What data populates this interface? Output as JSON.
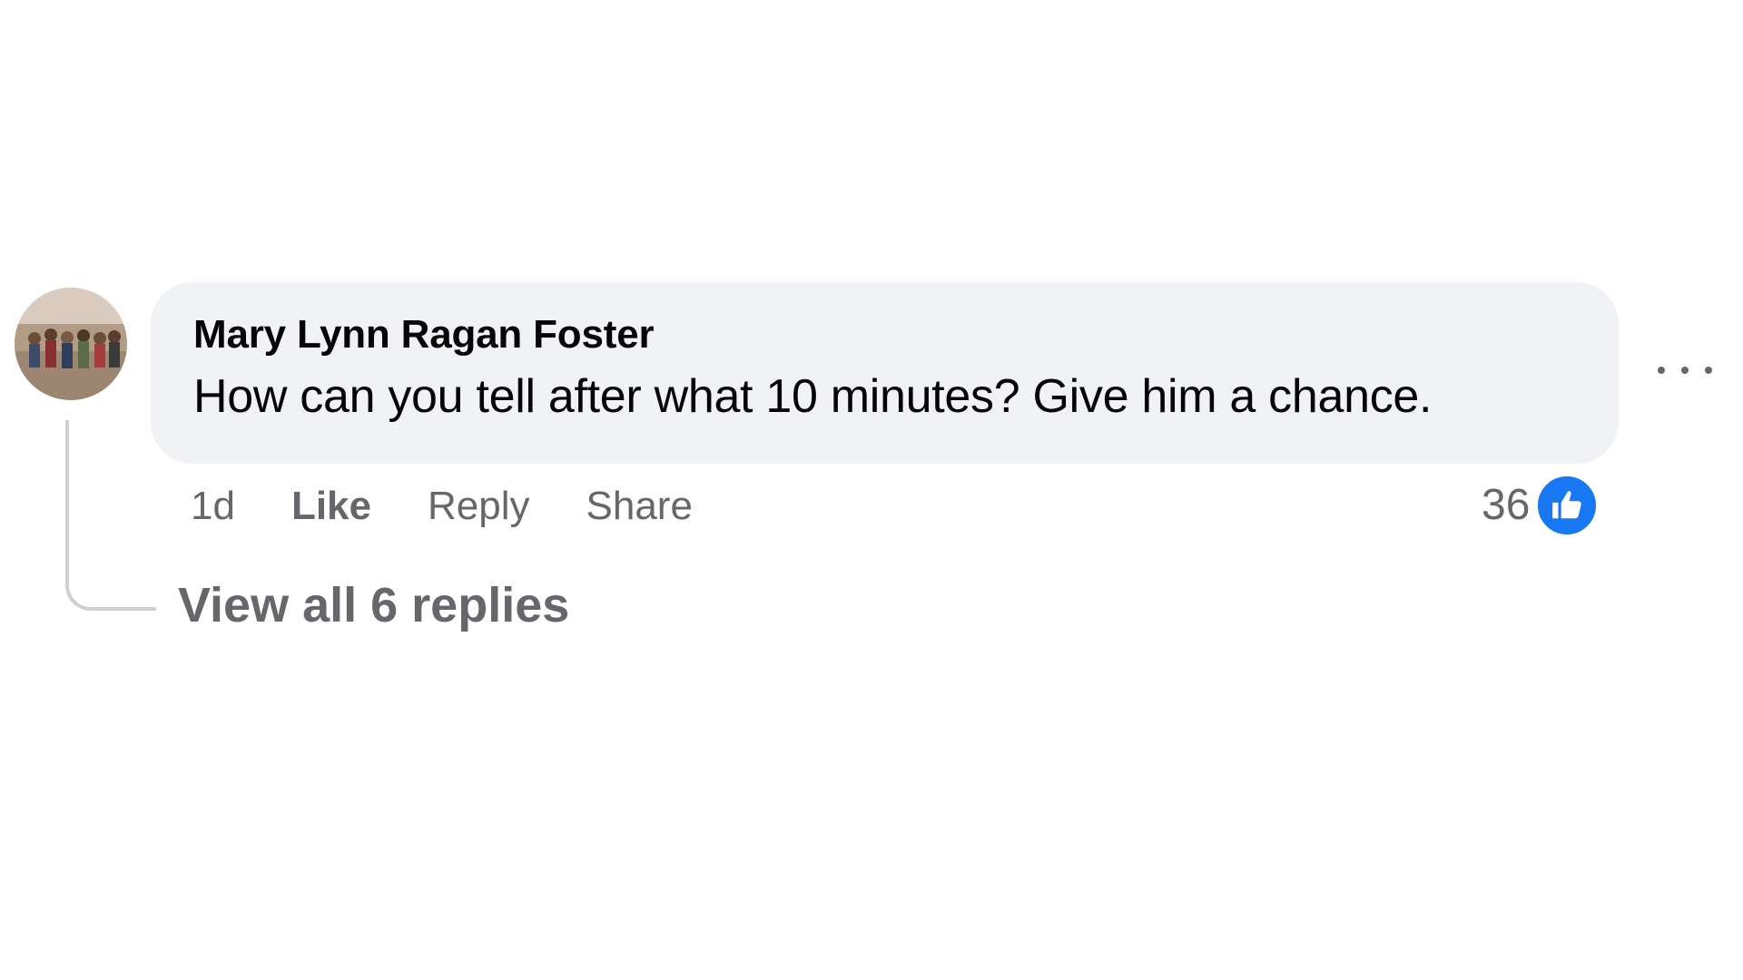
{
  "comment": {
    "author": "Mary Lynn Ragan Foster",
    "text": "How can you tell after what 10 minutes? Give him a chance.",
    "avatar_icon": "user-avatar-photo",
    "more_icon": "more-options-icon"
  },
  "actions": {
    "time": "1d",
    "like_label": "Like",
    "reply_label": "Reply",
    "share_label": "Share"
  },
  "reactions": {
    "count": "36",
    "icon": "thumbs-up-icon",
    "color": "#1877f2"
  },
  "replies": {
    "label": "View all 6 replies"
  },
  "colors": {
    "bubble": "#f0f2f5",
    "secondary_text": "#65676b",
    "primary_text": "#050505",
    "thread_line": "#ced0d4"
  }
}
